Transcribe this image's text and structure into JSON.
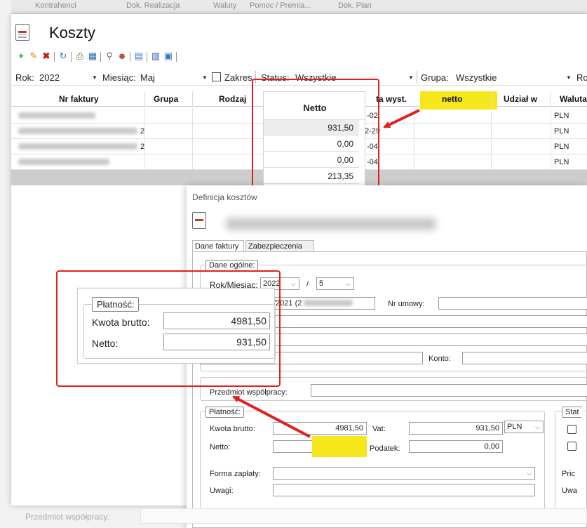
{
  "top_tabs": [
    "Kontrahenci",
    "Dok. Realizacja",
    "Waluty",
    "Pomoc / Premia...",
    "Dok. Plan"
  ],
  "window": {
    "title": "Koszty"
  },
  "filters": {
    "rok_label": "Rok:",
    "rok_value": "2022",
    "miesiac_label": "Miesiąc:",
    "miesiac_value": "Maj",
    "zakres_label": "Zakres",
    "status_label": "Status:",
    "status_value": "Wszystkie",
    "grupa_label": "Grupa:",
    "grupa_value": "Wszystkie",
    "ro_label": "Ro"
  },
  "grid": {
    "headers": [
      "Nr faktury",
      "Grupa",
      "Rodzaj",
      "ta wyst.",
      "netto",
      "Udział w",
      "Waluta"
    ],
    "rows": [
      {
        "nr_suffix": "",
        "date": "-02",
        "waluta": "PLN"
      },
      {
        "nr_suffix": "2",
        "date": "2-29",
        "waluta": "PLN"
      },
      {
        "nr_suffix": "2",
        "date": "-04",
        "waluta": "PLN"
      },
      {
        "nr_suffix": "",
        "date": "-04",
        "waluta": "PLN"
      }
    ]
  },
  "zoom_netto": {
    "header": "Netto",
    "values": [
      "931,50",
      "0,00",
      "0,00",
      "213,35"
    ]
  },
  "dialog": {
    "title": "Definicja kosztów",
    "tabs": [
      "Dane faktury",
      "Zabezpieczenia"
    ],
    "dane_ogolne": "Dane ogólne:",
    "rok_miesiac_label": "Rok/Miesiąc:",
    "rok_value": "2022",
    "slash": "/",
    "miesiac_value": "5",
    "nr_faktury_partial": "/2021 (2",
    "nr_umowy_label": "Nr umowy:",
    "konto_label": "Konto:",
    "przedmiot_label": "Przedmiot współpracy:",
    "platnosc_title": "Płatność:",
    "kwota_brutto_label": "Kwota brutto:",
    "kwota_brutto_value": "4981,50",
    "vat_label": "Vat:",
    "vat_value": "931,50",
    "waluta_value": "PLN",
    "netto_label": "Netto:",
    "podatek_label": "Podatek:",
    "podatek_value": "0,00",
    "forma_zaplaty_label": "Forma zapłaty:",
    "uwagi_label": "Uwagi:",
    "stat_title": "Stat",
    "pric_label": "Pric",
    "uwa_label": "Uwa"
  },
  "zoom_platnosc": {
    "title": "Płatność:",
    "kwota_brutto_label": "Kwota brutto:",
    "kwota_brutto_value": "4981,50",
    "netto_label": "Netto:",
    "netto_value": "931,50"
  },
  "background": {
    "przedmiot_label": "Przedmiot współpracy:"
  },
  "colors": {
    "annotation_red": "#e02020",
    "highlight_yellow": "#f5e71b"
  }
}
